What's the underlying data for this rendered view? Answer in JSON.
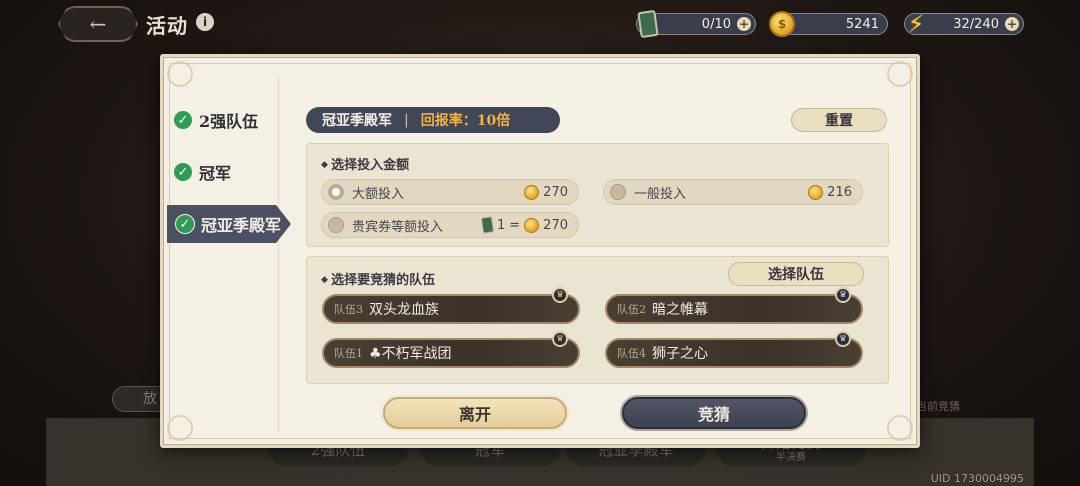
{
  "header": {
    "title": "活动",
    "info_icon": "i",
    "back_icon": "←",
    "resources": [
      {
        "icon": "ticket-icon",
        "value": "0/10"
      },
      {
        "icon": "coin-icon",
        "value": "5241"
      },
      {
        "icon": "energy-icon",
        "value": "32/240"
      }
    ],
    "plus": "+"
  },
  "background": {
    "left_button": "放",
    "tabs": [
      "2强队伍",
      "冠军",
      "冠亚季殿军",
      "开始比赛"
    ],
    "tab_sub": "半决赛",
    "side_text": "当前竞猜",
    "uid": "UID 1730004995"
  },
  "dialog": {
    "sidebar": [
      {
        "label": "2强队伍",
        "active": false
      },
      {
        "label": "冠军",
        "active": false
      },
      {
        "label": "冠亚季殿军",
        "active": true
      }
    ],
    "title": "冠亚季殿军",
    "separator": "|",
    "return_rate": "回报率：10倍",
    "reset": "重置",
    "invest_section": {
      "title": "选择投入金额",
      "options": [
        {
          "label": "大额投入",
          "cost": "270",
          "selected": true
        },
        {
          "label": "一般投入",
          "cost": "216",
          "selected": false
        },
        {
          "label": "贵宾券等额投入",
          "ticket_count": "1",
          "equals": "=",
          "cost": "270",
          "selected": false
        }
      ]
    },
    "team_section": {
      "title": "选择要竞猜的队伍",
      "select_button": "选择队伍",
      "teams": [
        {
          "tag": "队伍3",
          "name": "双头龙血族",
          "badge": "gold"
        },
        {
          "tag": "队伍2",
          "name": "暗之帷幕",
          "badge": "silver"
        },
        {
          "tag": "队伍1",
          "name": "♣不朽军战团",
          "badge": "gold"
        },
        {
          "tag": "队伍4",
          "name": "狮子之心",
          "badge": "silver"
        }
      ]
    },
    "leave": "离开",
    "guess": "竞猜"
  },
  "colors": {
    "accent_gold": "#f2b43c",
    "check_green": "#2e9c55",
    "dark_pill": "#424758"
  }
}
